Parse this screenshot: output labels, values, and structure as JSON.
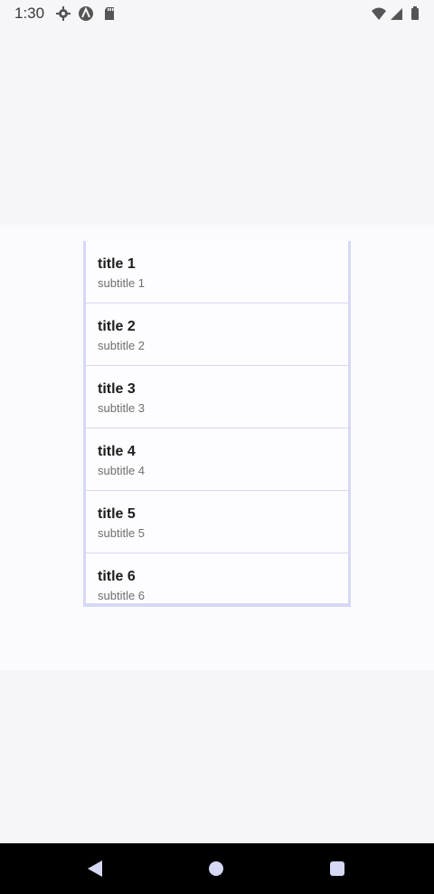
{
  "status_bar": {
    "time": "1:30",
    "icons": [
      "settings-icon",
      "a-icon",
      "sd-card-icon",
      "wifi-icon",
      "signal-icon",
      "battery-icon"
    ]
  },
  "list": {
    "items": [
      {
        "title": "title 1",
        "subtitle": "subtitle 1"
      },
      {
        "title": "title 2",
        "subtitle": "subtitle 2"
      },
      {
        "title": "title 3",
        "subtitle": "subtitle 3"
      },
      {
        "title": "title 4",
        "subtitle": "subtitle 4"
      },
      {
        "title": "title 5",
        "subtitle": "subtitle 5"
      },
      {
        "title": "title 6",
        "subtitle": "subtitle 6"
      }
    ]
  },
  "nav_bar": {
    "icons": [
      "back-icon",
      "home-icon",
      "recents-icon"
    ]
  },
  "colors": {
    "accent": "#d6d8f4",
    "background": "#f6f6f9"
  }
}
